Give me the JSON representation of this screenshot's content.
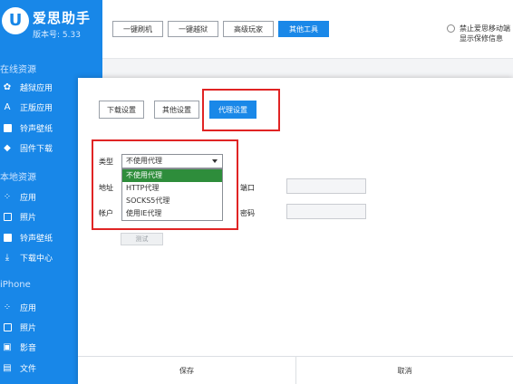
{
  "app": {
    "logo": "U",
    "name": "爱思助手",
    "version": "版本号: 5.33"
  },
  "sidebar": {
    "sections": [
      {
        "title": "在线资源",
        "items": [
          {
            "icon": "flower-icon",
            "label": "越狱应用"
          },
          {
            "icon": "appstore-icon",
            "label": "正版应用"
          },
          {
            "icon": "ringtone-icon",
            "label": "铃声壁纸"
          },
          {
            "icon": "box-icon",
            "label": "固件下载"
          }
        ]
      },
      {
        "title": "本地资源",
        "items": [
          {
            "icon": "apps-grid-icon",
            "label": "应用"
          },
          {
            "icon": "photo-icon",
            "label": "照片"
          },
          {
            "icon": "ringtone-icon",
            "label": "铃声壁纸"
          },
          {
            "icon": "download-icon",
            "label": "下载中心"
          }
        ]
      },
      {
        "title": "iPhone",
        "items": [
          {
            "icon": "apps-grid-icon",
            "label": "应用"
          },
          {
            "icon": "photo-icon",
            "label": "照片"
          },
          {
            "icon": "video-icon",
            "label": "影音"
          },
          {
            "icon": "file-icon",
            "label": "文件"
          }
        ]
      }
    ]
  },
  "toolbar": {
    "buttons": [
      "一键刷机",
      "一键越狱",
      "高级玩家",
      "其他工具"
    ],
    "active_index": 3,
    "checkbox_label": "禁止爱思移动端显示保修信息"
  },
  "dialog": {
    "tabs": [
      "下载设置",
      "其他设置",
      "代理设置"
    ],
    "active_tab": 2,
    "fields": {
      "type_label": "类型",
      "type_value": "不使用代理",
      "address_label": "地址",
      "port_label": "端口",
      "account_label": "帐户",
      "password_label": "密码"
    },
    "dropdown_options": [
      "不使用代理",
      "HTTP代理",
      "SOCKS5代理",
      "使用IE代理"
    ],
    "selected_option": 0,
    "test_button": "测试",
    "save_button": "保存",
    "cancel_button": "取消"
  },
  "colors": {
    "brand_blue": "#1887e8",
    "highlight_red": "#e02424",
    "dropdown_selected": "#2e8d3b"
  }
}
